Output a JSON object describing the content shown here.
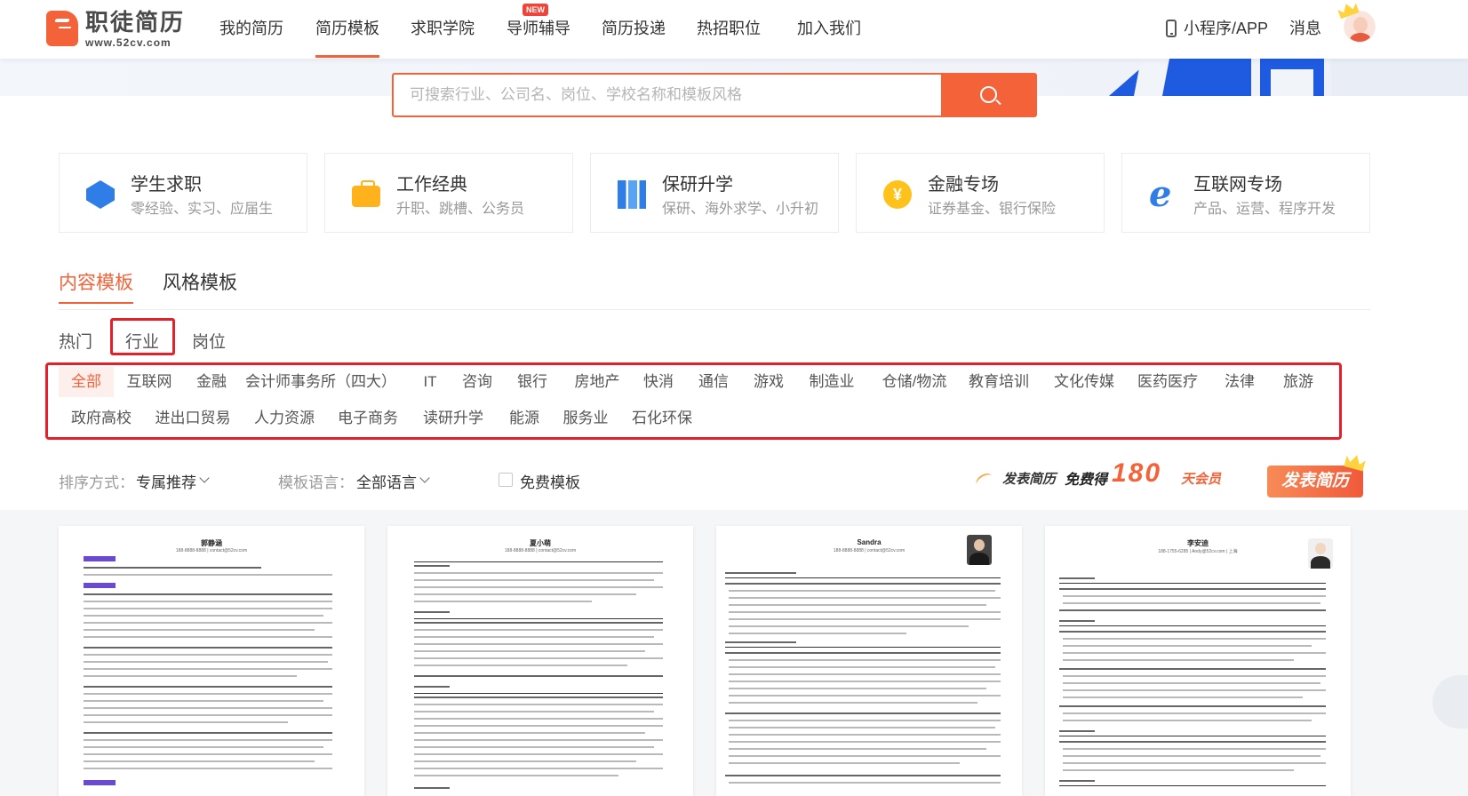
{
  "logo": {
    "title": "职徒简历",
    "url": "www.52cv.com"
  },
  "nav": {
    "items": [
      "我的简历",
      "简历模板",
      "求职学院",
      "导师辅导",
      "简历投递",
      "热招职位",
      "加入我们"
    ],
    "new_badge": "NEW",
    "miniapp": "小程序/APP",
    "messages": "消息"
  },
  "search": {
    "placeholder": "可搜索行业、公司名、岗位、学校名称和模板风格"
  },
  "categories": [
    {
      "title": "学生求职",
      "sub": "零经验、实习、应届生",
      "icon": "graduation-icon"
    },
    {
      "title": "工作经典",
      "sub": "升职、跳槽、公务员",
      "icon": "briefcase-icon"
    },
    {
      "title": "保研升学",
      "sub": "保研、海外求学、小升初",
      "icon": "books-icon"
    },
    {
      "title": "金融专场",
      "sub": "证券基金、银行保险",
      "icon": "coin-icon",
      "glyph": "¥"
    },
    {
      "title": "互联网专场",
      "sub": "产品、运营、程序开发",
      "icon": "browser-e-icon",
      "glyph": "e"
    }
  ],
  "tabs": [
    "内容模板",
    "风格模板"
  ],
  "subtabs": [
    "热门",
    "行业",
    "岗位"
  ],
  "industries": {
    "row1": [
      "全部",
      "互联网",
      "金融",
      "会计师事务所（四大）",
      "IT",
      "咨询",
      "银行",
      "房地产",
      "快消",
      "通信",
      "游戏",
      "制造业",
      "仓储/物流",
      "教育培训",
      "文化传媒",
      "医药医疗",
      "法律",
      "旅游"
    ],
    "row2": [
      "政府高校",
      "进出口贸易",
      "人力资源",
      "电子商务",
      "读研升学",
      "能源",
      "服务业",
      "石化环保"
    ]
  },
  "filters": {
    "sort_label": "排序方式：",
    "sort_value": "专属推荐",
    "lang_label": "模板语言：",
    "lang_value": "全部语言",
    "free_label": "免费模板"
  },
  "promo": {
    "part1": "发表简历",
    "part2": "免费得",
    "number": "180",
    "part3": "天会员"
  },
  "publish_button": "发表简历",
  "templates": [
    {
      "name": "郭静涵",
      "contact": "188-8888-8888 | contact@52cv.com"
    },
    {
      "name": "夏小萌",
      "contact": "188-8888-8888 | contact@52cv.com"
    },
    {
      "name": "Sandra",
      "contact": "188-8888-8888 | contact@52cv.com"
    },
    {
      "name": "李安迪",
      "contact": "188-1755-6285 | Andy@52cv.com | 上海"
    }
  ],
  "colors": {
    "accent": "#f4623a",
    "highlight_box": "#e4202a"
  }
}
